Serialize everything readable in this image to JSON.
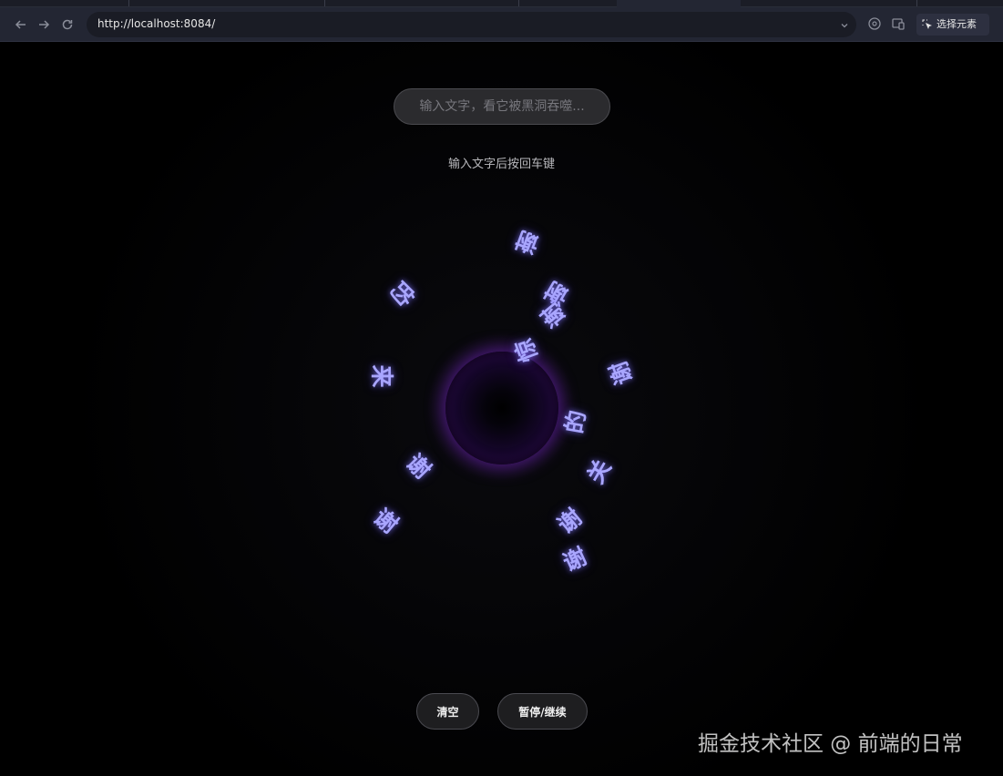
{
  "browser": {
    "url": "http://localhost:8084/",
    "back_icon": "arrow-left-icon",
    "forward_icon": "arrow-right-icon",
    "reload_icon": "reload-icon",
    "pick_element_label": "选择元素"
  },
  "page": {
    "input_placeholder": "输入文字，看它被黑洞吞噬...",
    "hint": "输入文字后按回车键",
    "chars": [
      "谢",
      "的",
      "谢",
      "来",
      "谢",
      "谢",
      "的",
      "关",
      "谢",
      "谢",
      "谢",
      "惊",
      "谢"
    ],
    "clear_label": "清空",
    "pause_label": "暂停/继续",
    "accent_color": "#a9a6ff"
  },
  "watermark": "掘金技术社区 @ 前端的日常"
}
